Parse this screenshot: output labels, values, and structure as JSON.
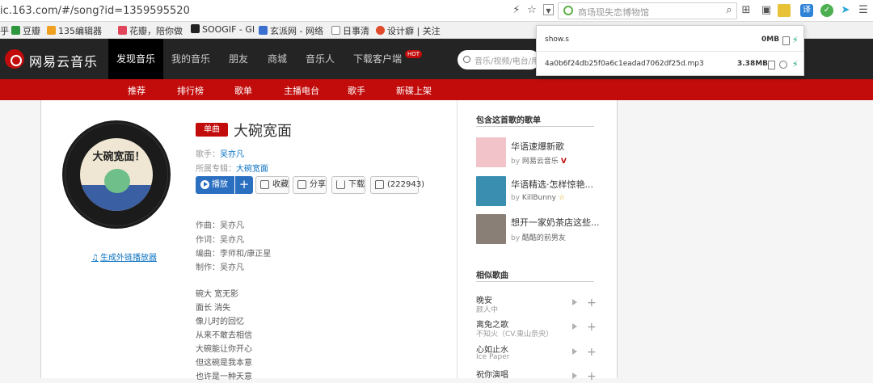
{
  "browser": {
    "url": "ic.163.com/#/song?id=1359595520",
    "search_placeholder": "商场现失恋博物馆",
    "bookmarks": [
      "乎",
      "豆瓣",
      "135编辑器",
      "花瓣，陪你做",
      "SOOGIF - GI",
      "玄派网 - 网络",
      "日事清",
      "设计癖 | 关注"
    ]
  },
  "download_popup": {
    "items": [
      {
        "name": "show.s",
        "size": "0MB"
      },
      {
        "name": "4a0b6f24db25f0a6c1eadad7062df25d.mp3",
        "size": "3.38MB"
      }
    ]
  },
  "site": {
    "logo": "网易云音乐",
    "nav": [
      "发现音乐",
      "我的音乐",
      "朋友",
      "商城",
      "音乐人",
      "下载客户端"
    ],
    "hot_badge": "HOT",
    "search_placeholder": "音乐/视频/电台/用户",
    "subnav": [
      "推荐",
      "排行榜",
      "歌单",
      "主播电台",
      "歌手",
      "新碟上架"
    ]
  },
  "song": {
    "tag": "单曲",
    "title": "大碗宽面",
    "singer_label": "歌手：",
    "singer": "吴亦凡",
    "album_label": "所属专辑：",
    "album": "大碗宽面",
    "cover_text": "大碗宽面！",
    "buttons": {
      "play": "播放",
      "add": "+",
      "collect": "收藏",
      "share": "分享",
      "download": "下载",
      "comments": "(222943)"
    },
    "external_player": "生成外链播放器",
    "credits": [
      "作曲：吴亦凡",
      "作词：吴亦凡",
      "编曲：李师和/康正星",
      "制作：吴亦凡"
    ],
    "lyrics": [
      "碗大 宽无影",
      "面长 消失",
      "像儿时的回忆",
      "从来不敢去相信",
      "大碗能让你开心",
      "但这碗是我本意",
      "也许是一种天意"
    ]
  },
  "sidebar": {
    "playlists_heading": "包含这首歌的歌单",
    "playlists": [
      {
        "title": "华语速爆新歌",
        "by_label": "by",
        "author": "网易云音乐",
        "badge": "V",
        "thumb_color": "#f2c4c9"
      },
      {
        "title": "华语精选·怎样惊艳...",
        "by_label": "by",
        "author": "KillBunny",
        "badge": "☆",
        "thumb_color": "#3a8fb0"
      },
      {
        "title": "想开一家奶茶店这些...",
        "by_label": "by",
        "author": "酷酷的前男友",
        "badge": "",
        "thumb_color": "#8a7f77"
      }
    ],
    "similar_heading": "相似歌曲",
    "similar": [
      {
        "title": "晚安",
        "artist": "颜人中"
      },
      {
        "title": "离兔之歌",
        "artist": "不知火（CV.東山奈央）"
      },
      {
        "title": "心如止水",
        "artist": "Ice Paper"
      },
      {
        "title": "祝你演唱",
        "artist": ""
      }
    ]
  },
  "colors": {
    "brand_red": "#c20c0c",
    "nav_dark": "#242424",
    "link_blue": "#0c73c2"
  }
}
